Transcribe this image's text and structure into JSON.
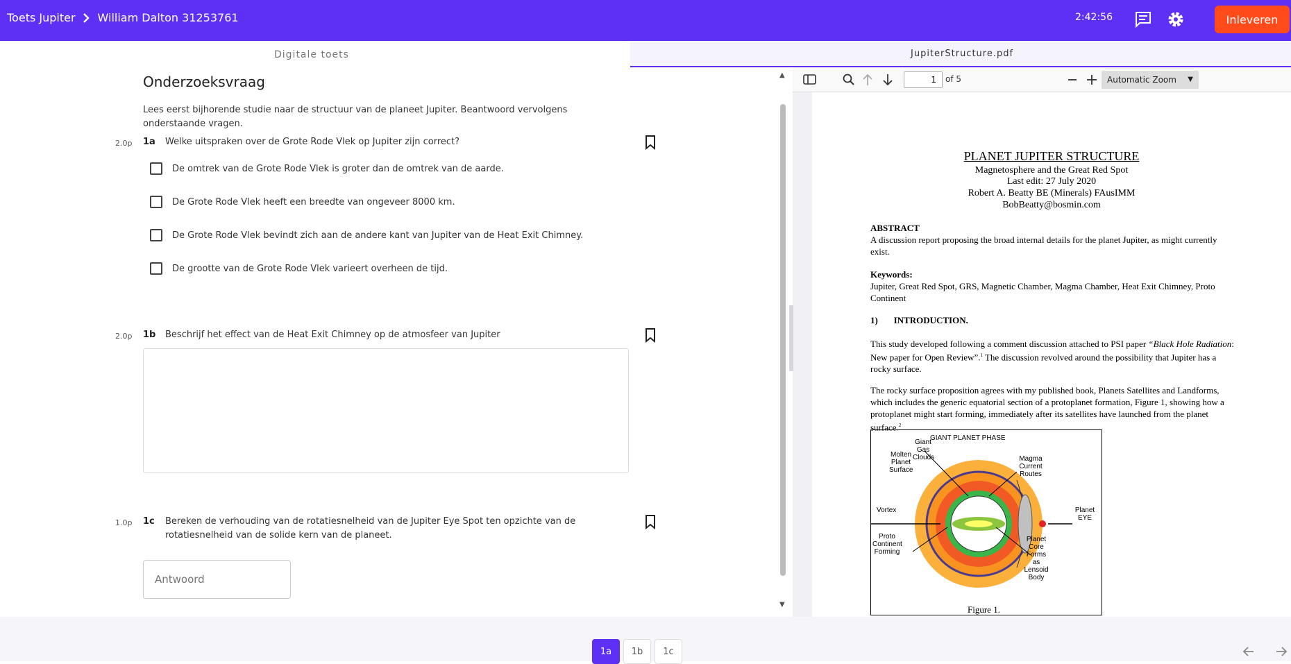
{
  "header": {
    "test_name": "Toets Jupiter",
    "student": "William Dalton 31253761",
    "timer": "2:42:56",
    "submit_label": "Inleveren"
  },
  "left": {
    "section_label": "Digitale toets",
    "heading": "Onderzoeksvraag",
    "intro": "Lees eerst bijhorende studie naar de structuur van de planeet Jupiter. Beantwoord vervolgens onderstaande vragen.",
    "questions": [
      {
        "points": "2.0p",
        "number": "1a",
        "text": "Welke uitspraken over de Grote Rode Vlek op Jupiter zijn correct?",
        "options": [
          "De omtrek van de Grote Rode Vlek is groter dan de omtrek van de aarde.",
          "De Grote Rode Vlek heeft een breedte van ongeveer 8000 km.",
          "De Grote Rode Vlek bevindt zich aan de andere kant van Jupiter van de Heat Exit Chimney.",
          "De grootte van de Grote Rode Vlek varieert overheen de tijd."
        ]
      },
      {
        "points": "2.0p",
        "number": "1b",
        "text": "Beschrijf het effect van de Heat Exit Chimney op de atmosfeer van Jupiter"
      },
      {
        "points": "1.0p",
        "number": "1c",
        "text": "Bereken de verhouding van de rotatiesnelheid van de Jupiter Eye Spot ten opzichte van de rotatiesnelheid van de solide kern van de planeet.",
        "answer_placeholder": "Antwoord"
      }
    ]
  },
  "pdf": {
    "filename": "JupiterStructure.pdf",
    "page_current": "1",
    "page_total": "of 5",
    "zoom": "Automatic Zoom",
    "title": "PLANET JUPITER STRUCTURE",
    "subtitle": "Magnetosphere and the Great Red Spot",
    "edit": "Last edit: 27 July 2020",
    "author": "Robert A. Beatty BE (Minerals) FAusIMM",
    "email": "BobBeatty@bosmin.com",
    "abstract_title": "ABSTRACT",
    "abstract": "A discussion report proposing the broad internal details for the planet Jupiter, as might currently exist.",
    "keywords_title": "Keywords:",
    "keywords": "Jupiter, Great Red Spot, GRS, Magnetic Chamber, Magma Chamber, Heat Exit Chimney, Proto Continent",
    "intro_title": "1)       INTRODUCTION.",
    "para1_a": "This study developed following a comment discussion attached to PSI paper ",
    "para1_italic": "“Black Hole Radiation",
    "para1_b": ": New paper for Open Review”.",
    "para1_c": " The discussion revolved around the possibility that Jupiter has a rocky surface.",
    "para2": "The rocky surface proposition agrees with my published book, Planets Satellites and Landforms, which includes the generic equatorial section of a protoplanet formation, Figure 1, showing how a protoplanet might start forming, immediately after its satellites have launched from the planet surface.",
    "figure": {
      "title": "GIANT PLANET PHASE",
      "labels": {
        "gas": "Giant Gas Clouds",
        "molten": "Molten Planet Surface",
        "magma": "Magma Current Routes",
        "vortex": "Vortex",
        "eye": "Planet EYE",
        "proto": "Proto Continent Forming",
        "core": "Planet Core Forms as Lensoid Body"
      },
      "caption": "Figure 1."
    }
  },
  "nav": {
    "tabs": [
      "1a",
      "1b",
      "1c"
    ],
    "active": "1a"
  }
}
